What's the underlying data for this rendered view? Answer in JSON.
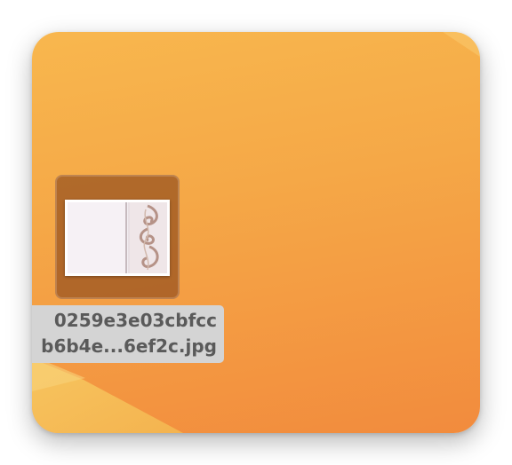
{
  "desktop": {
    "wallpaper_colors": [
      "#f8b74e",
      "#f5a847",
      "#f28b3d"
    ],
    "selected_file": {
      "icon": "image-file-icon",
      "name_line1": "0259e3e03cbfcc",
      "name_line2": "b6b4e...6ef2c.jpg"
    }
  }
}
